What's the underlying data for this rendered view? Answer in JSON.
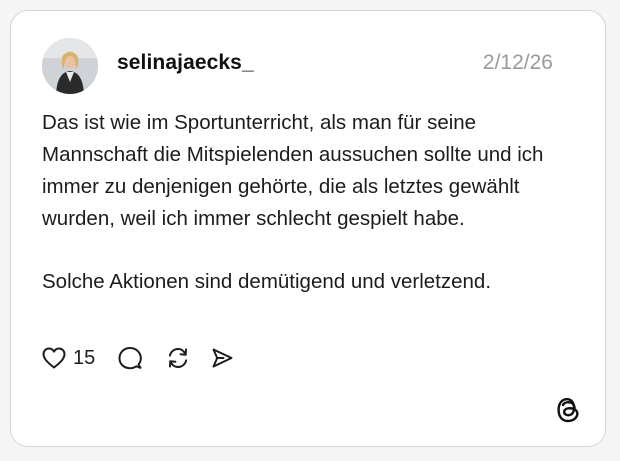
{
  "post": {
    "username": "selinajaecks_",
    "date": "2/12/26",
    "paragraphs": [
      "Das ist wie im Sportunterricht, als man für seine Mannschaft die Mitspielenden aussuchen sollte und ich immer zu denjenigen gehörte, die als letztes gewählt wurden, weil ich immer schlecht gespielt habe.",
      "Solche Aktionen sind demütigend und verletzend."
    ]
  },
  "actions": {
    "like_icon": "heart-icon",
    "like_count": "15",
    "reply_icon": "comment-icon",
    "repost_icon": "repost-icon",
    "share_icon": "send-icon"
  },
  "branding": {
    "logo": "threads-logo-icon"
  },
  "colors": {
    "background": "#f5f5f5",
    "card": "#ffffff",
    "border": "#d6d6d6",
    "date_text": "#9a9a9a",
    "primary_text": "#1c1c1c"
  }
}
